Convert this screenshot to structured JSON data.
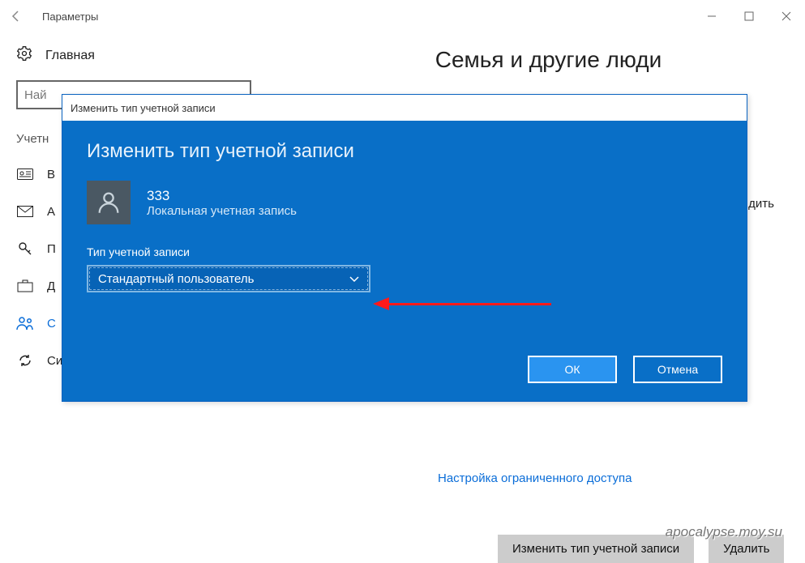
{
  "titlebar": {
    "title": "Параметры"
  },
  "home_label": "Главная",
  "search_placeholder": "Най",
  "section_label": "Учетн",
  "nav": [
    {
      "label": "В"
    },
    {
      "label": "А"
    },
    {
      "label": "П"
    },
    {
      "label": "Д"
    },
    {
      "label": "С",
      "active": true,
      "id": "family"
    },
    {
      "label": "Синхронизация ваших параметров",
      "id": "sync"
    }
  ],
  "page_title": "Семья и другие люди",
  "truncated_right_text": "дить",
  "button_change_type": "Изменить тип учетной записи",
  "button_delete": "Удалить",
  "link_restricted": "Настройка ограниченного доступа",
  "modal": {
    "caption": "Изменить тип учетной записи",
    "heading": "Изменить тип учетной записи",
    "user_name": "333",
    "user_sub": "Локальная учетная запись",
    "field_label": "Тип учетной записи",
    "combo_value": "Стандартный пользователь",
    "ok": "ОК",
    "cancel": "Отмена"
  },
  "watermark": "apocalypse.moy.su"
}
